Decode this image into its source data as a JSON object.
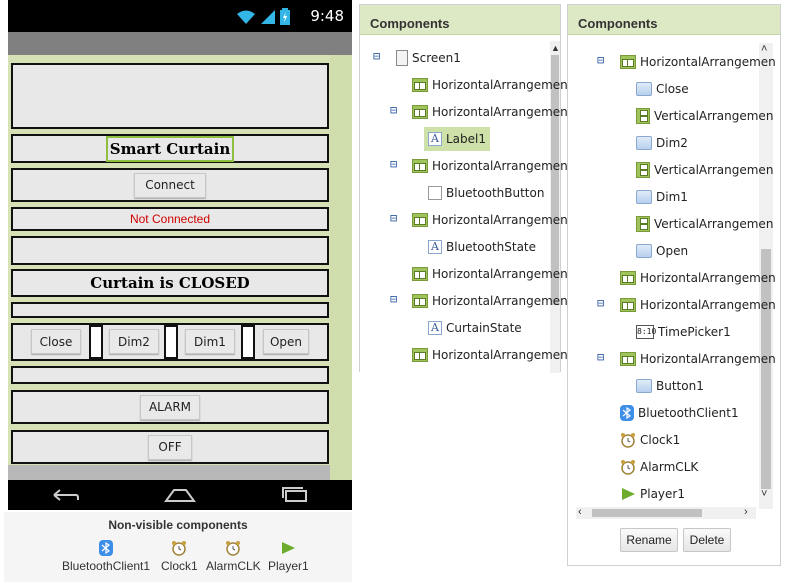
{
  "phone": {
    "time": "9:48",
    "title_label": "Smart Curtain",
    "connect_button": "Connect",
    "status_label": "Not Connected",
    "curtain_state": "Curtain is CLOSED",
    "close_button": "Close",
    "dim2_button": "Dim2",
    "dim1_button": "Dim1",
    "open_button": "Open",
    "alarm_button": "ALARM",
    "off_button": "OFF",
    "status_color": "#d10000"
  },
  "non_visible": {
    "title": "Non-visible components",
    "items": [
      "BluetoothClient1",
      "Clock1",
      "AlarmCLK",
      "Player1"
    ]
  },
  "tree_left": {
    "header": "Components",
    "rows": [
      {
        "label": "Screen1",
        "icon": "screen-icon"
      },
      {
        "label": "HorizontalArrangemen",
        "icon": "horizontal-arrangement-icon"
      },
      {
        "label": "HorizontalArrangemen",
        "icon": "horizontal-arrangement-icon"
      },
      {
        "label": "Label1",
        "icon": "label-icon"
      },
      {
        "label": "HorizontalArrangemen",
        "icon": "horizontal-arrangement-icon"
      },
      {
        "label": "BluetoothButton",
        "icon": "list-picker-icon"
      },
      {
        "label": "HorizontalArrangemen",
        "icon": "horizontal-arrangement-icon"
      },
      {
        "label": "BluetoothState",
        "icon": "label-icon"
      },
      {
        "label": "HorizontalArrangemen",
        "icon": "horizontal-arrangement-icon"
      },
      {
        "label": "HorizontalArrangemen",
        "icon": "horizontal-arrangement-icon"
      },
      {
        "label": "CurtainState",
        "icon": "label-icon"
      },
      {
        "label": "HorizontalArrangemen",
        "icon": "horizontal-arrangement-icon"
      }
    ]
  },
  "tree_right": {
    "header": "Components",
    "rows": [
      {
        "label": "HorizontalArrangemen",
        "icon": "horizontal-arrangement-icon"
      },
      {
        "label": "Close",
        "icon": "button-icon"
      },
      {
        "label": "VerticalArrangemen",
        "icon": "vertical-arrangement-icon"
      },
      {
        "label": "Dim2",
        "icon": "button-icon"
      },
      {
        "label": "VerticalArrangemen",
        "icon": "vertical-arrangement-icon"
      },
      {
        "label": "Dim1",
        "icon": "button-icon"
      },
      {
        "label": "VerticalArrangemen",
        "icon": "vertical-arrangement-icon"
      },
      {
        "label": "Open",
        "icon": "button-icon"
      },
      {
        "label": "HorizontalArrangemen",
        "icon": "horizontal-arrangement-icon"
      },
      {
        "label": "HorizontalArrangemen",
        "icon": "horizontal-arrangement-icon"
      },
      {
        "label": "TimePicker1",
        "icon": "time-picker-icon"
      },
      {
        "label": "HorizontalArrangemen",
        "icon": "horizontal-arrangement-icon"
      },
      {
        "label": "Button1",
        "icon": "button-icon"
      },
      {
        "label": "BluetoothClient1",
        "icon": "bluetooth-icon"
      },
      {
        "label": "Clock1",
        "icon": "clock-icon"
      },
      {
        "label": "AlarmCLK",
        "icon": "clock-icon"
      },
      {
        "label": "Player1",
        "icon": "player-icon"
      }
    ],
    "rename_button": "Rename",
    "delete_button": "Delete"
  },
  "colors": {
    "panel_header": "#dde8c4",
    "selection": "#cde1a8",
    "accent_blue": "#2c5aa0"
  }
}
